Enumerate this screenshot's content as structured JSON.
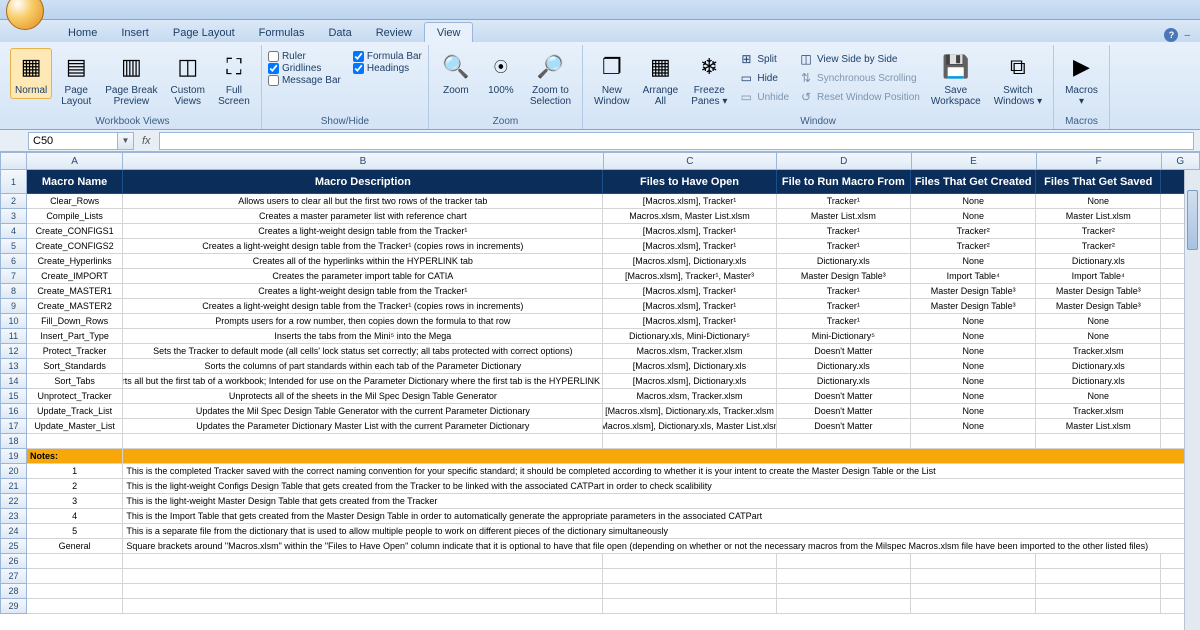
{
  "tabs": [
    "Home",
    "Insert",
    "Page Layout",
    "Formulas",
    "Data",
    "Review",
    "View"
  ],
  "activeTab": "View",
  "ribbon": {
    "views": {
      "normal": "Normal",
      "pageLayout": "Page\nLayout",
      "pageBreak": "Page Break\nPreview",
      "custom": "Custom\nViews",
      "fullScreen": "Full\nScreen",
      "groupLabel": "Workbook Views"
    },
    "showHide": {
      "ruler": "Ruler",
      "gridlines": "Gridlines",
      "messageBar": "Message Bar",
      "formulaBar": "Formula Bar",
      "headings": "Headings",
      "groupLabel": "Show/Hide"
    },
    "zoom": {
      "zoom": "Zoom",
      "pct": "100%",
      "sel": "Zoom to\nSelection",
      "groupLabel": "Zoom"
    },
    "window": {
      "new": "New\nWindow",
      "arrange": "Arrange\nAll",
      "freeze": "Freeze\nPanes ▾",
      "split": "Split",
      "hide": "Hide",
      "unhide": "Unhide",
      "sideBySide": "View Side by Side",
      "sync": "Synchronous Scrolling",
      "reset": "Reset Window Position",
      "save": "Save\nWorkspace",
      "switch": "Switch\nWindows ▾",
      "groupLabel": "Window"
    },
    "macros": {
      "macros": "Macros\n▾",
      "groupLabel": "Macros"
    }
  },
  "nameBox": "C50",
  "columns": [
    "A",
    "B",
    "C",
    "D",
    "E",
    "F",
    "G"
  ],
  "headers": {
    "A": "Macro Name",
    "B": "Macro Description",
    "C": "Files to Have Open",
    "D": "File to Run Macro From",
    "E": "Files That Get Created",
    "F": "Files That Get Saved"
  },
  "data": [
    {
      "name": "Clear_Rows",
      "desc": "Allows users to clear all but the first two rows of the tracker tab",
      "open": "[Macros.xlsm], Tracker¹",
      "run": "Tracker¹",
      "created": "None",
      "saved": "None"
    },
    {
      "name": "Compile_Lists",
      "desc": "Creates a master parameter list with reference chart",
      "open": "Macros.xlsm, Master List.xlsm",
      "run": "Master List.xlsm",
      "created": "None",
      "saved": "Master List.xlsm"
    },
    {
      "name": "Create_CONFIGS1",
      "desc": "Creates a light-weight design table from the Tracker¹",
      "open": "[Macros.xlsm], Tracker¹",
      "run": "Tracker¹",
      "created": "Tracker²",
      "saved": "Tracker²"
    },
    {
      "name": "Create_CONFIGS2",
      "desc": "Creates a light-weight design table from the Tracker¹ (copies rows in increments)",
      "open": "[Macros.xlsm], Tracker¹",
      "run": "Tracker¹",
      "created": "Tracker²",
      "saved": "Tracker²"
    },
    {
      "name": "Create_Hyperlinks",
      "desc": "Creates all of the hyperlinks within the HYPERLINK tab",
      "open": "[Macros.xlsm], Dictionary.xls",
      "run": "Dictionary.xls",
      "created": "None",
      "saved": "Dictionary.xls"
    },
    {
      "name": "Create_IMPORT",
      "desc": "Creates the parameter import table for CATIA",
      "open": "[Macros.xlsm], Tracker¹, Master³",
      "run": "Master Design Table³",
      "created": "Import Table⁴",
      "saved": "Import Table⁴"
    },
    {
      "name": "Create_MASTER1",
      "desc": "Creates a light-weight design table from the Tracker¹",
      "open": "[Macros.xlsm], Tracker¹",
      "run": "Tracker¹",
      "created": "Master Design Table³",
      "saved": "Master Design Table³"
    },
    {
      "name": "Create_MASTER2",
      "desc": "Creates a light-weight design table from the Tracker¹ (copies rows in increments)",
      "open": "[Macros.xlsm], Tracker¹",
      "run": "Tracker¹",
      "created": "Master Design Table³",
      "saved": "Master Design Table³"
    },
    {
      "name": "Fill_Down_Rows",
      "desc": "Prompts users for a row number, then copies down the formula to that row",
      "open": "[Macros.xlsm], Tracker¹",
      "run": "Tracker¹",
      "created": "None",
      "saved": "None"
    },
    {
      "name": "Insert_Part_Type",
      "desc": "Inserts the tabs from the Mini⁵ into the Mega",
      "open": "Dictionary.xls, Mini-Dictionary⁵",
      "run": "Mini-Dictionary⁵",
      "created": "None",
      "saved": "None"
    },
    {
      "name": "Protect_Tracker",
      "desc": "Sets the Tracker to default mode (all cells' lock status set correctly; all tabs protected with correct options)",
      "open": "Macros.xlsm, Tracker.xlsm",
      "run": "Doesn't Matter",
      "created": "None",
      "saved": "Tracker.xlsm"
    },
    {
      "name": "Sort_Standards",
      "desc": "Sorts the columns of part standards within each tab of the Parameter Dictionary",
      "open": "[Macros.xlsm], Dictionary.xls",
      "run": "Dictionary.xls",
      "created": "None",
      "saved": "Dictionary.xls"
    },
    {
      "name": "Sort_Tabs",
      "desc": "Sorts all but the first tab of a workbook; Intended for use on the Parameter Dictionary where the first tab is the HYPERLINK tab",
      "open": "[Macros.xlsm], Dictionary.xls",
      "run": "Dictionary.xls",
      "created": "None",
      "saved": "Dictionary.xls"
    },
    {
      "name": "Unprotect_Tracker",
      "desc": "Unprotects all of the sheets in the Mil Spec Design Table Generator",
      "open": "Macros.xlsm, Tracker.xlsm",
      "run": "Doesn't Matter",
      "created": "None",
      "saved": "None"
    },
    {
      "name": "Update_Track_List",
      "desc": "Updates the Mil Spec Design Table Generator with the current Parameter Dictionary",
      "open": "[Macros.xlsm], Dictionary.xls, Tracker.xlsm",
      "run": "Doesn't Matter",
      "created": "None",
      "saved": "Tracker.xlsm"
    },
    {
      "name": "Update_Master_List",
      "desc": "Updates the Parameter Dictionary Master List with the current Parameter Dictionary",
      "open": "[Macros.xlsm], Dictionary.xls, Master List.xlsm",
      "run": "Doesn't Matter",
      "created": "None",
      "saved": "Master List.xlsm"
    }
  ],
  "notesHeader": "Notes:",
  "notes": [
    {
      "n": "1",
      "t": "This is the completed Tracker saved with the correct naming convention for your specific standard; it should be completed according to whether it is your intent to create the Master Design Table or the List"
    },
    {
      "n": "2",
      "t": "This is the light-weight Configs Design Table that gets created from the Tracker to be linked with the associated CATPart in order to check scalibility"
    },
    {
      "n": "3",
      "t": "This is the light-weight Master Design Table that gets created from the Tracker"
    },
    {
      "n": "4",
      "t": "This is the Import Table that gets created from the Master Design Table in order to automatically generate the appropriate parameters in the associated CATPart"
    },
    {
      "n": "5",
      "t": "This is a separate file from the dictionary that is used to allow multiple people to work on different pieces of the dictionary simultaneously"
    },
    {
      "n": "General",
      "t": "Square brackets around \"Macros.xlsm\" within the \"Files to Have Open\" column indicate that it is optional to have that file open (depending on whether or not the necessary macros from the Milspec Macros.xlsm file have been imported to the other listed files)"
    }
  ]
}
